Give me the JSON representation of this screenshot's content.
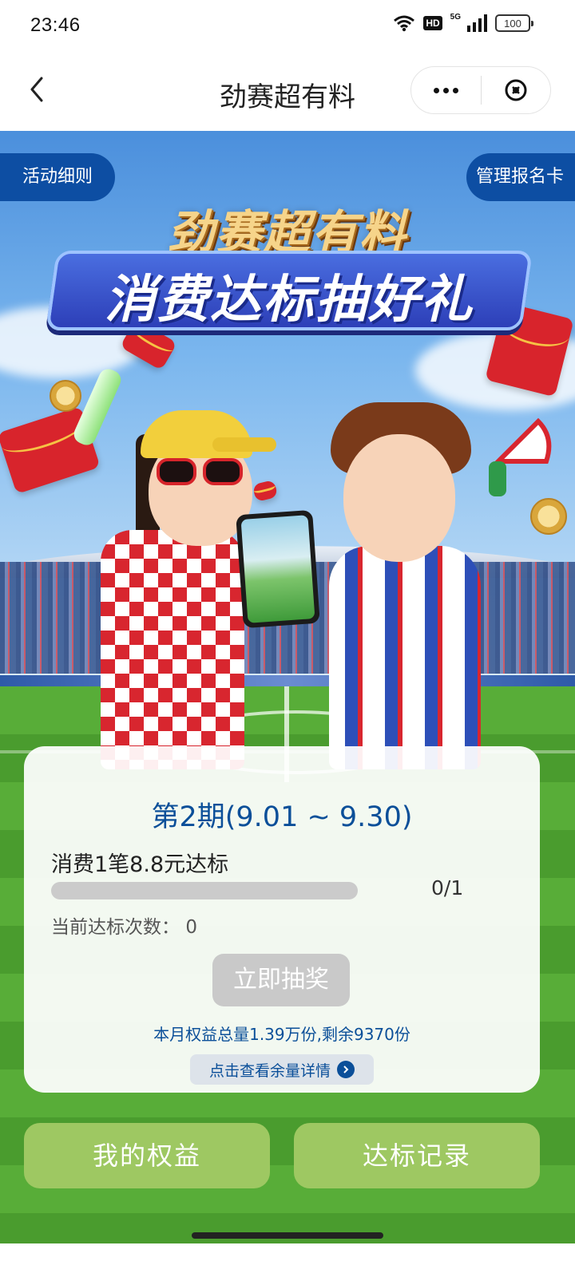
{
  "status_bar": {
    "time": "23:46",
    "network": "5G",
    "hd_badge": "HD",
    "battery": "100"
  },
  "nav": {
    "title": "劲赛超有料"
  },
  "banner": {
    "rules_label": "活动细则",
    "manage_label": "管理报名卡",
    "headline_top": "劲赛超有料",
    "headline_main": "消费达标抽好礼"
  },
  "card": {
    "period": "第2期(9.01 ~  9.30)",
    "condition": "消费1笔8.8元达标",
    "progress": {
      "current": 0,
      "total": 1,
      "label": "0/1"
    },
    "count_label": "当前达标次数：",
    "count_value": "0",
    "draw_button": "立即抽奖",
    "quota_text": "本月权益总量1.39万份,剩余9370份",
    "detail_link": "点击查看余量详情"
  },
  "actions": {
    "my_benefits": "我的权益",
    "records": "达标记录"
  },
  "colors": {
    "primary_blue": "#0b4f99",
    "pill_blue": "#0d4ea3",
    "button_green": "#9ec862",
    "disabled_gray": "#c9c9c9"
  }
}
